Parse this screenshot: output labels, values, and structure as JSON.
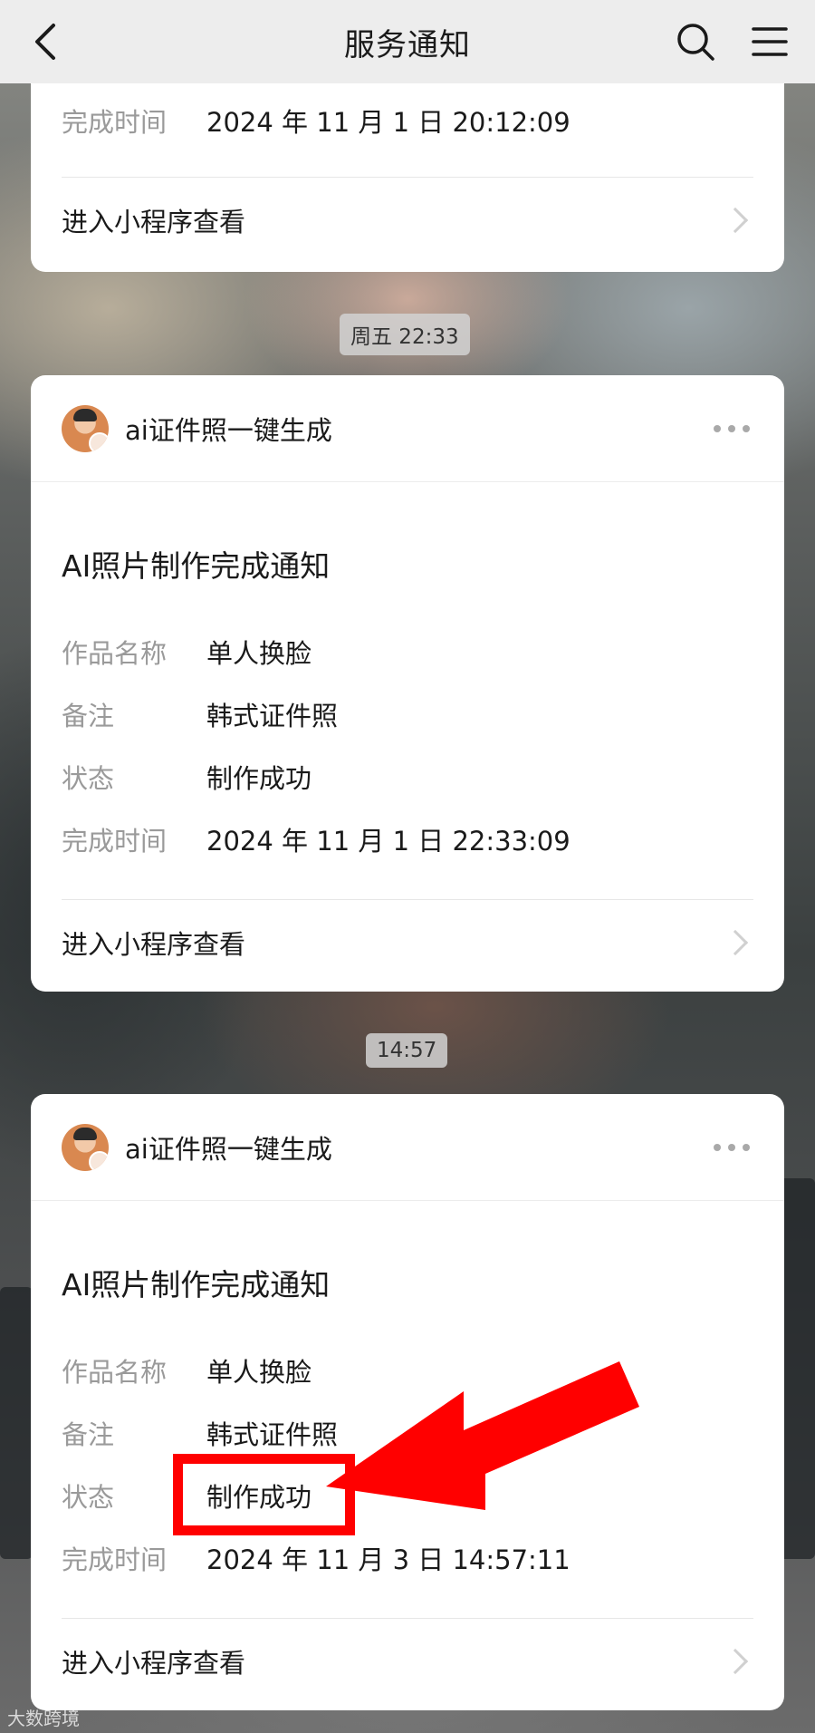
{
  "header": {
    "title": "服务通知"
  },
  "top_card": {
    "time_label": "完成时间",
    "time_value": "2024 年 11 月 1 日 20:12:09",
    "footer_link": "进入小程序查看"
  },
  "messages": [
    {
      "timestamp": "周五 22:33",
      "app_name": "ai证件照一键生成",
      "notice_title": "AI照片制作完成通知",
      "rows": [
        {
          "label": "作品名称",
          "value": "单人换脸"
        },
        {
          "label": "备注",
          "value": "韩式证件照"
        },
        {
          "label": "状态",
          "value": "制作成功"
        },
        {
          "label": "完成时间",
          "value": "2024 年 11 月 1 日 22:33:09"
        }
      ],
      "footer_link": "进入小程序查看"
    },
    {
      "timestamp": "14:57",
      "app_name": "ai证件照一键生成",
      "notice_title": "AI照片制作完成通知",
      "rows": [
        {
          "label": "作品名称",
          "value": "单人换脸"
        },
        {
          "label": "备注",
          "value": "韩式证件照"
        },
        {
          "label": "状态",
          "value": "制作成功"
        },
        {
          "label": "完成时间",
          "value": "2024 年 11 月 3 日 14:57:11"
        }
      ],
      "footer_link": "进入小程序查看"
    }
  ],
  "annotation": {
    "color": "#ff0000"
  },
  "watermark": "大数跨境"
}
